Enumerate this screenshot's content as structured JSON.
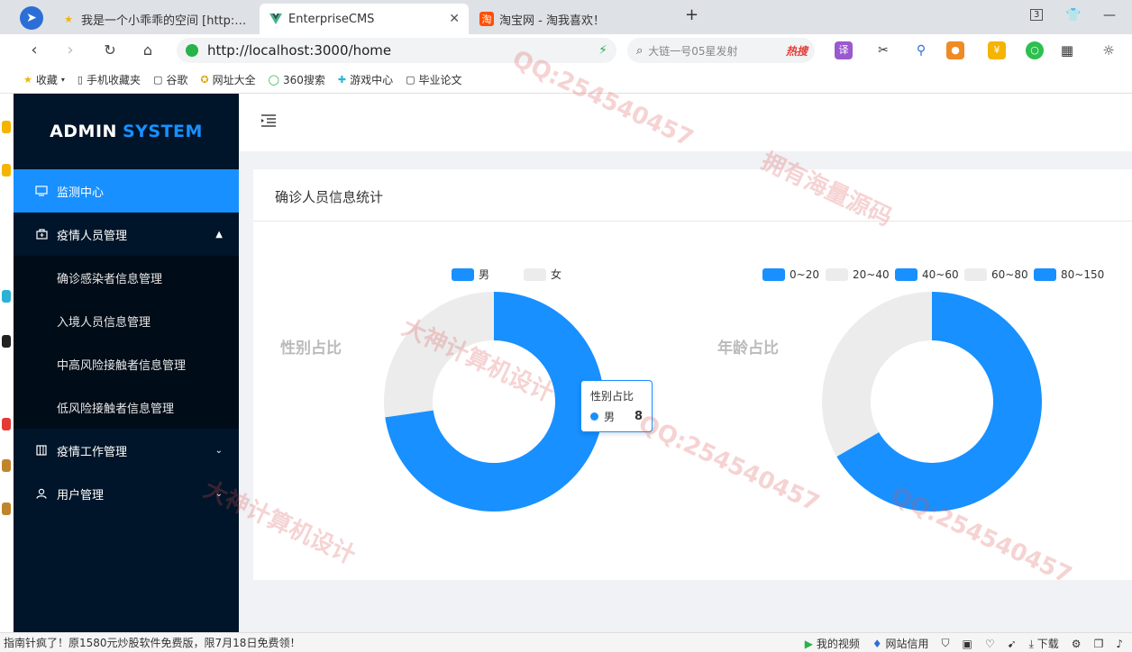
{
  "browser": {
    "tabs": [
      {
        "title": "我是一个小乖乖的空间 [http://2",
        "icon": "star-icon",
        "active": false
      },
      {
        "title": "EnterpriseCMS",
        "icon": "vue-logo-icon",
        "active": true
      },
      {
        "title": "淘宝网 - 淘我喜欢！",
        "icon": "taobao-icon",
        "active": false
      }
    ],
    "new_tab": "+",
    "tab_count": "3",
    "url": "http://localhost:3000/home",
    "search_placeholder": "大链一号05星发射",
    "hot_label": "热搜",
    "translate_label": "译",
    "bookmarks": [
      {
        "label": "收藏",
        "icon": "star-icon"
      },
      {
        "label": "手机收藏夹",
        "icon": "phone-icon"
      },
      {
        "label": "谷歌",
        "icon": "page-icon"
      },
      {
        "label": "网址大全",
        "icon": "nav-icon"
      },
      {
        "label": "360搜索",
        "icon": "search-360-icon"
      },
      {
        "label": "游戏中心",
        "icon": "game-icon"
      },
      {
        "label": "毕业论文",
        "icon": "page-icon"
      }
    ]
  },
  "app": {
    "logo_main": "ADMIN",
    "logo_accent": "SYSTEM",
    "menu": {
      "dashboard": "监测中心",
      "epidemic_staff": "疫情人员管理",
      "sub_items": [
        "确诊感染者信息管理",
        "入境人员信息管理",
        "中高风险接触者信息管理",
        "低风险接触者信息管理"
      ],
      "epidemic_work": "疫情工作管理",
      "user_mgmt": "用户管理"
    },
    "card_title": "确诊人员信息统计",
    "tooltip": {
      "title": "性别占比",
      "label": "男",
      "value": "8"
    }
  },
  "chart_data": [
    {
      "type": "pie",
      "title": "性别占比",
      "donut": true,
      "legend_position": "top",
      "categories": [
        "男",
        "女"
      ],
      "values": [
        8,
        3
      ],
      "colors": [
        "#1890ff",
        "#ececec"
      ]
    },
    {
      "type": "pie",
      "title": "年龄占比",
      "donut": true,
      "legend_position": "top-right",
      "categories": [
        "0~20",
        "20~40",
        "40~60",
        "60~80",
        "80~150"
      ],
      "values": [
        0,
        0,
        2,
        1,
        0
      ],
      "colors": [
        "#1890ff",
        "#ececec",
        "#1890ff",
        "#ececec",
        "#1890ff"
      ]
    }
  ],
  "statusbar": {
    "news": "指南针疯了！原1580元炒股软件免费版，限7月18日免费领！",
    "video": "我的视频",
    "credit": "网站信用",
    "download": "下载"
  },
  "watermark": {
    "qq": "QQ:254540457",
    "slogan1": "大神计算机设计",
    "slogan2": "拥有海量源码"
  }
}
